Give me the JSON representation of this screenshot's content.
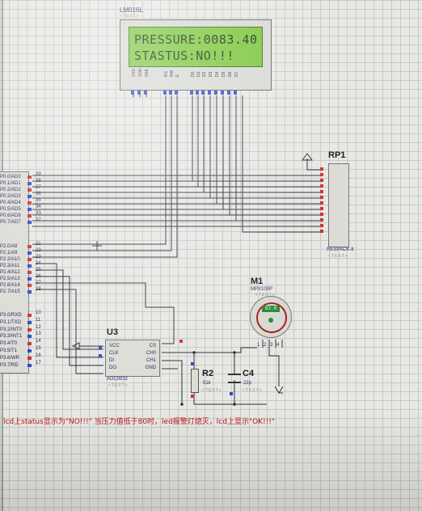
{
  "lcd": {
    "part": "LM016L",
    "text_tag": "<TEXT>",
    "line1": "PRESSURE:0083.40",
    "line2": "STASTUS:NO!!!",
    "pins": [
      "VSS",
      "VDD",
      "VEE",
      "RS",
      "RW",
      "E",
      "D0",
      "D1",
      "D2",
      "D3",
      "D4",
      "D5",
      "D6",
      "D7"
    ]
  },
  "mcu": {
    "port0": [
      "P0.0/AD0",
      "P0.1/AD1",
      "P0.2/AD2",
      "P0.3/AD3",
      "P0.4/AD4",
      "P0.5/AD5",
      "P0.6/AD6",
      "P0.7/AD7"
    ],
    "port0_pins": [
      "39",
      "38",
      "37",
      "36",
      "35",
      "34",
      "33",
      "32"
    ],
    "port2": [
      "P2.0/A8",
      "P2.1/A9",
      "P2.2/A10",
      "P2.3/A11",
      "P2.4/A12",
      "P2.5/A13",
      "P2.6/A14",
      "P2.7/A15"
    ],
    "port2_pins": [
      "21",
      "22",
      "23",
      "24",
      "25",
      "26",
      "27",
      "28"
    ],
    "port3": [
      "P3.0/RXD",
      "P3.1/TXD",
      "P3.2/INT0",
      "P3.3/INT1",
      "P3.4/T0",
      "P3.5/T1",
      "P3.6/WR",
      "P3.7/RD"
    ],
    "port3_pins": [
      "10",
      "11",
      "12",
      "13",
      "14",
      "15",
      "16",
      "17"
    ]
  },
  "rp1": {
    "ref": "RP1",
    "part": "RESPACK-8",
    "text_tag": "<TEXT>"
  },
  "u3": {
    "ref": "U3",
    "part": "ADC0832",
    "text_tag": "<TEXT>",
    "left_pins": [
      "VCC",
      "CLK",
      "DI",
      "DO"
    ],
    "right_pins": [
      "CS",
      "CH0",
      "CH1",
      "GND"
    ]
  },
  "m1": {
    "ref": "M1",
    "part": "MPX100P",
    "text_tag": "<TEXT>",
    "readout": "83.0",
    "pins": [
      "1",
      "2",
      "3",
      "4"
    ]
  },
  "r2": {
    "ref": "R2",
    "value": "51k",
    "text_tag": "<TEXT>"
  },
  "c4": {
    "ref": "C4",
    "value": "22p",
    "text_tag": "<TEXT>"
  },
  "note": "lcd上status显示为\"NO!!!\" 当压力值低于80时，led报警灯熄灭，lcd上显示\"OK!!!\""
}
